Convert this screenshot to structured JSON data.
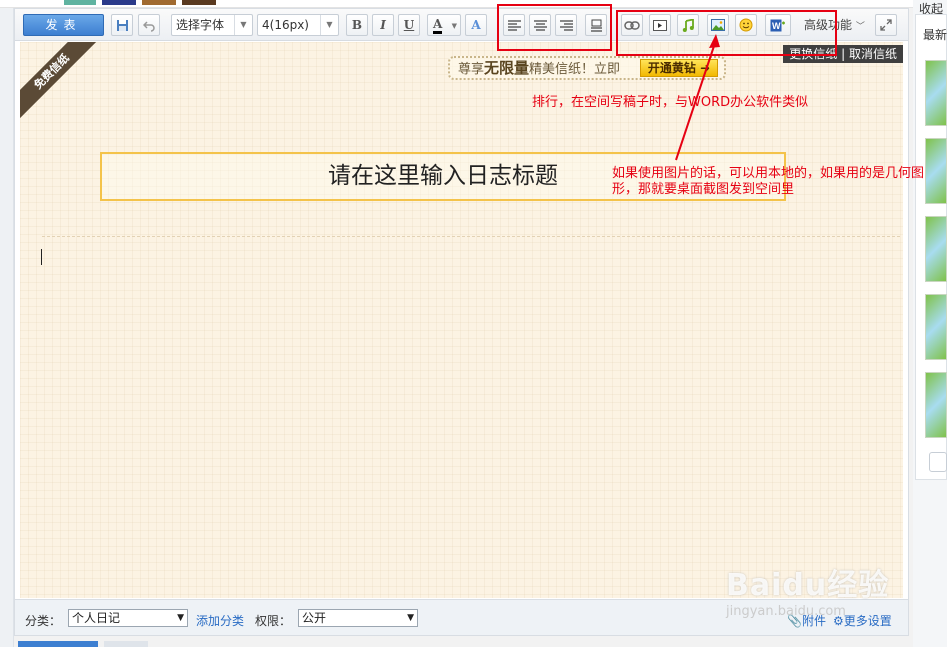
{
  "toolbar": {
    "publish_label": "发表",
    "font_select": "选择字体",
    "size_select": "4(16px)",
    "bold": "B",
    "italic": "I",
    "underline": "U",
    "font_color": "A",
    "highlight": "A",
    "advanced_label": "高级功能"
  },
  "paper": {
    "ribbon_text": "免费信纸",
    "promo_prefix": "尊享",
    "promo_bold": "无限量",
    "promo_suffix": "精美信纸！立即",
    "promo_vip_button": "开通黄钻",
    "switch_paper": "更换信纸",
    "cancel_paper": "取消信纸",
    "title_placeholder": "请在这里输入日志标题"
  },
  "bottom": {
    "category_label": "分类：",
    "category_value": "个人日记",
    "add_category": "添加分类",
    "permission_label": "权限：",
    "permission_value": "公开",
    "attachment": "附件",
    "more_settings": "更多设置"
  },
  "sidebar": {
    "top_label": "收起",
    "latest_label": "最新"
  },
  "annotations": {
    "align_note": "排行，在空间写稿子时，与WORD办公软件类似",
    "image_note": "如果使用图片的话，可以用本地的，如果用的是几何图形，那就要桌面截图发到空间里"
  },
  "watermark": {
    "brand": "Baidu经验",
    "url": "jingyan.baidu.com"
  },
  "colors": {
    "annotation_red": "#e60012",
    "publish_blue": "#3d7fd1",
    "paper_bg": "#fcf3e3",
    "title_border": "#f4c34a"
  }
}
